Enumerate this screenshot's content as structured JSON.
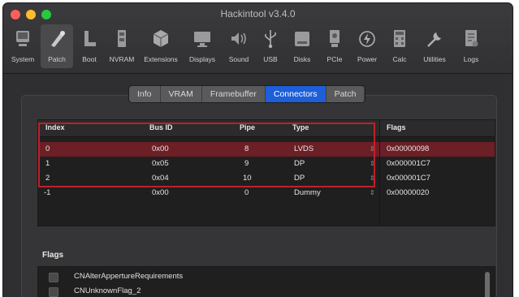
{
  "window": {
    "title": "Hackintool v3.4.0"
  },
  "toolbar": {
    "items": [
      {
        "label": "System",
        "icon": "system-icon"
      },
      {
        "label": "Patch",
        "icon": "patch-icon",
        "active": true
      },
      {
        "label": "Boot",
        "icon": "boot-icon"
      },
      {
        "label": "NVRAM",
        "icon": "nvram-icon"
      },
      {
        "label": "Extensions",
        "icon": "extensions-icon"
      },
      {
        "label": "Displays",
        "icon": "displays-icon"
      },
      {
        "label": "Sound",
        "icon": "sound-icon"
      },
      {
        "label": "USB",
        "icon": "usb-icon"
      },
      {
        "label": "Disks",
        "icon": "disks-icon"
      },
      {
        "label": "PCIe",
        "icon": "pcie-icon"
      },
      {
        "label": "Power",
        "icon": "power-icon"
      },
      {
        "label": "Calc",
        "icon": "calc-icon"
      },
      {
        "label": "Utilities",
        "icon": "utilities-icon"
      },
      {
        "label": "Logs",
        "icon": "logs-icon"
      }
    ]
  },
  "tabs": [
    "Info",
    "VRAM",
    "Framebuffer",
    "Connectors",
    "Patch"
  ],
  "selected_tab": "Connectors",
  "table": {
    "headers": {
      "index": "Index",
      "bus_id": "Bus ID",
      "pipe": "Pipe",
      "type": "Type",
      "flags": "Flags"
    },
    "rows": [
      {
        "index": "0",
        "bus_id": "0x00",
        "pipe": "8",
        "type": "LVDS",
        "flags": "0x00000098"
      },
      {
        "index": "1",
        "bus_id": "0x05",
        "pipe": "9",
        "type": "DP",
        "flags": "0x000001C7"
      },
      {
        "index": "2",
        "bus_id": "0x04",
        "pipe": "10",
        "type": "DP",
        "flags": "0x000001C7"
      },
      {
        "index": "-1",
        "bus_id": "0x00",
        "pipe": "0",
        "type": "Dummy",
        "flags": "0x00000020"
      }
    ]
  },
  "flags_section": {
    "title": "Flags",
    "items": [
      "CNAlterAppertureRequirements",
      "CNUnknownFlag_2"
    ]
  },
  "colors": {
    "accent": "#1d5ed9",
    "selection_row": "#6d1f26",
    "highlight_outline": "#c21f2b"
  }
}
